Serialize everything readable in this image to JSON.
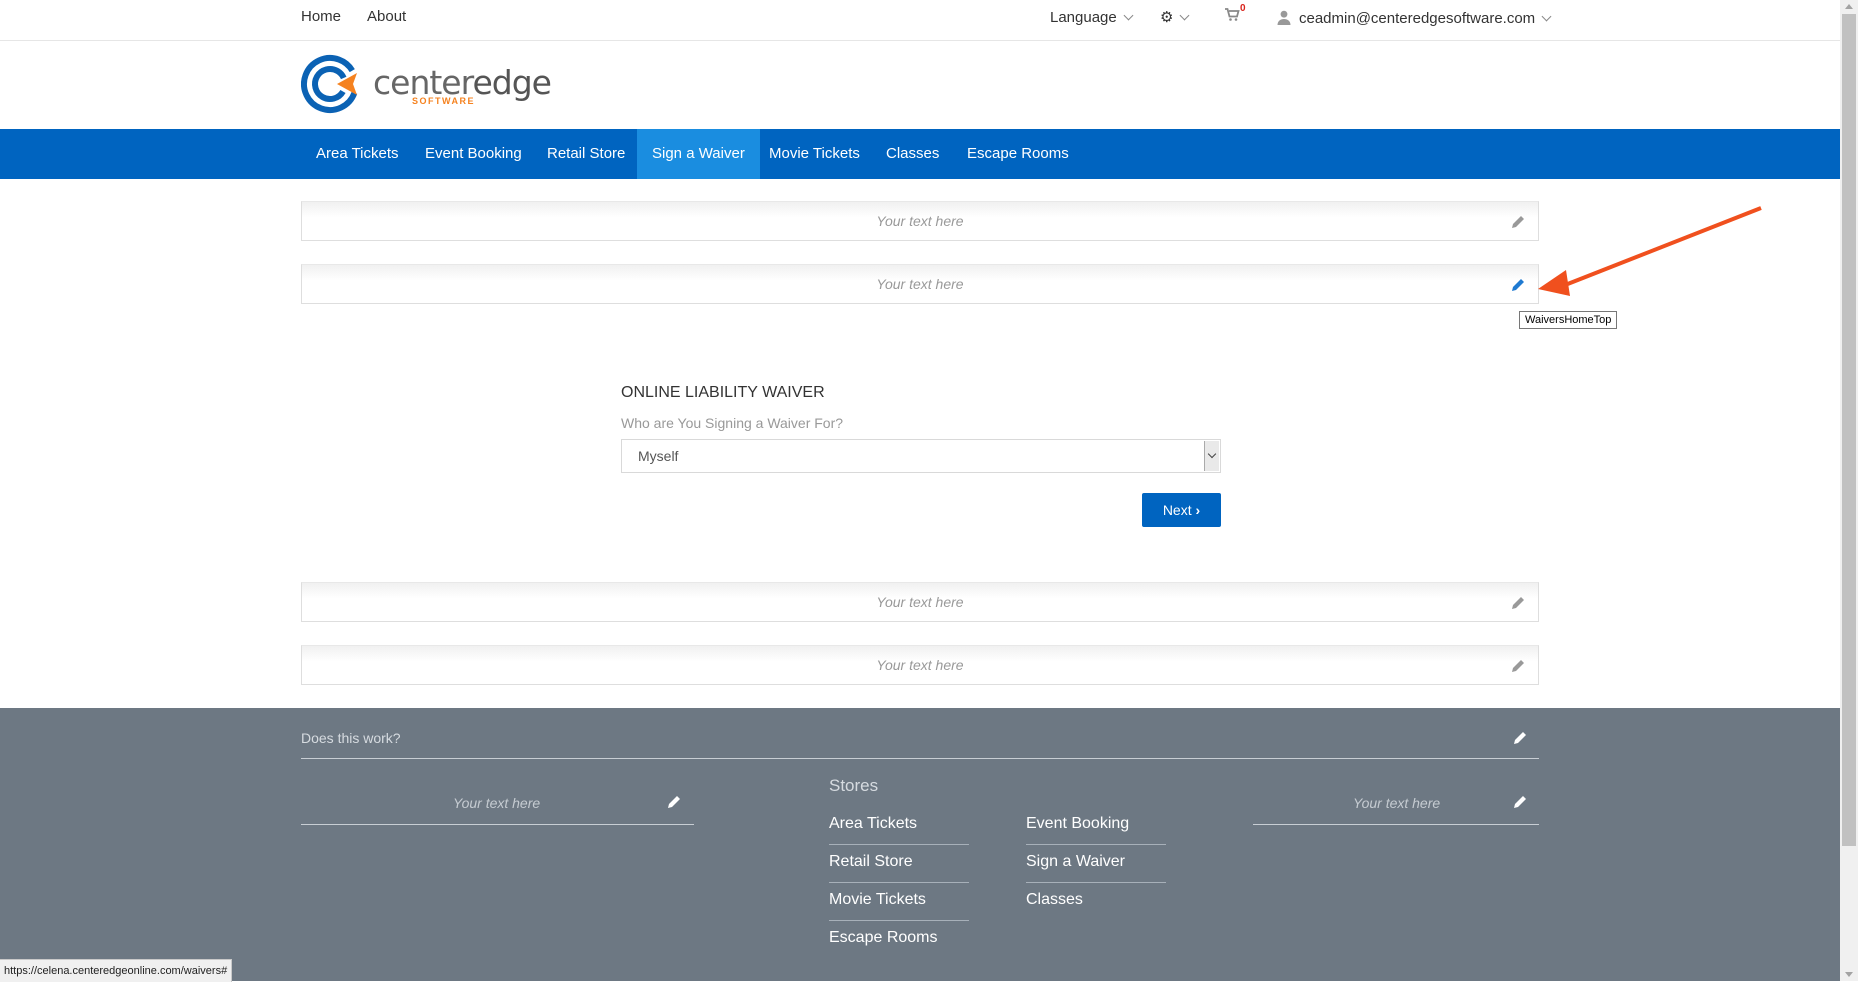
{
  "topbar": {
    "home": "Home",
    "about": "About",
    "language": "Language",
    "cart_count": "0",
    "user_email": "ceadmin@centeredgesoftware.com"
  },
  "logo": {
    "word_a": "center",
    "word_b": "edge",
    "sub": "SOFTWARE"
  },
  "nav": {
    "items": [
      "Area Tickets",
      "Event Booking",
      "Retail Store",
      "Sign a Waiver",
      "Movie Tickets",
      "Classes",
      "Escape Rooms"
    ],
    "active": "Sign a Waiver"
  },
  "content_blocks": {
    "placeholder": "Your text here"
  },
  "tooltip": "WaiversHomeTop",
  "waiver": {
    "title": "ONLINE LIABILITY WAIVER",
    "label": "Who are You Signing a Waiver For?",
    "selected": "Myself",
    "next": "Next"
  },
  "footer": {
    "question": "Does this work?",
    "placeholder": "Your text here",
    "stores_heading": "Stores",
    "links_col1": [
      "Area Tickets",
      "Retail Store",
      "Movie Tickets",
      "Escape Rooms"
    ],
    "links_col2": [
      "Event Booking",
      "Sign a Waiver",
      "Classes"
    ]
  },
  "statusbar": "https://celena.centeredgeonline.com/waivers#",
  "colors": {
    "nav": "#0064c0",
    "nav_active": "#1a8de0",
    "footer": "#6d7883",
    "annotation": "#f0501e",
    "pencil_active": "#1f7ad1"
  }
}
